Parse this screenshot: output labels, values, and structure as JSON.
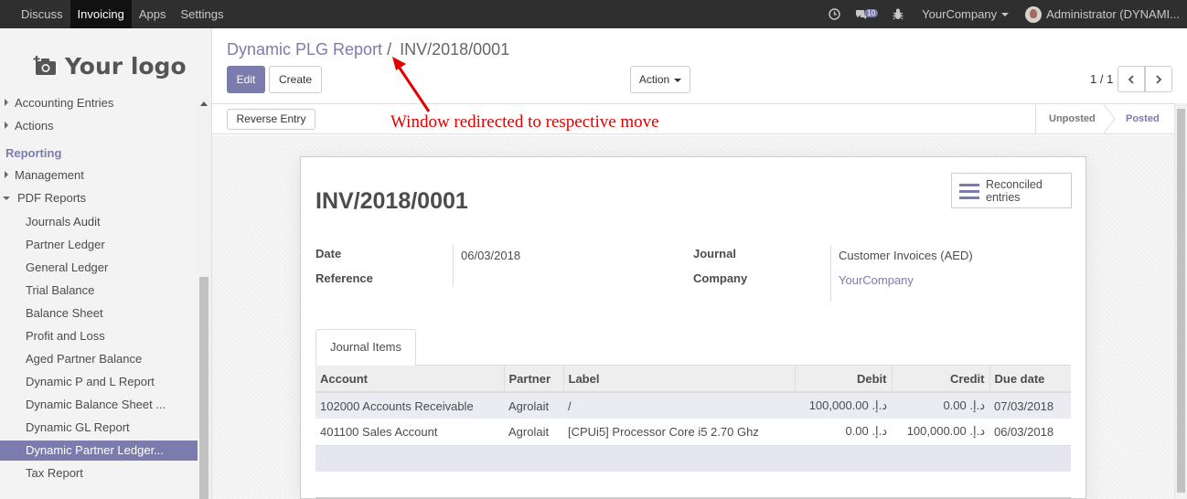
{
  "topbar": {
    "menu": [
      "Discuss",
      "Invoicing",
      "Apps",
      "Settings"
    ],
    "active_index": 1,
    "messages_count": "10",
    "company": "YourCompany",
    "user": "Administrator (DYNAMI..."
  },
  "sidebar": {
    "logo_text": "Your logo",
    "items": [
      {
        "type": "group",
        "label": "Accounting Entries"
      },
      {
        "type": "group",
        "label": "Actions"
      },
      {
        "type": "head",
        "label": "Reporting"
      },
      {
        "type": "group",
        "label": "Management"
      },
      {
        "type": "group-open",
        "label": "PDF Reports"
      },
      {
        "type": "sub",
        "label": "Journals Audit"
      },
      {
        "type": "sub",
        "label": "Partner Ledger"
      },
      {
        "type": "sub",
        "label": "General Ledger"
      },
      {
        "type": "sub",
        "label": "Trial Balance"
      },
      {
        "type": "sub",
        "label": "Balance Sheet"
      },
      {
        "type": "sub",
        "label": "Profit and Loss"
      },
      {
        "type": "sub",
        "label": "Aged Partner Balance"
      },
      {
        "type": "sub",
        "label": "Dynamic P and L Report"
      },
      {
        "type": "sub",
        "label": "Dynamic Balance Sheet ..."
      },
      {
        "type": "sub",
        "label": "Dynamic GL Report"
      },
      {
        "type": "sub-selected",
        "label": "Dynamic Partner Ledger..."
      },
      {
        "type": "sub",
        "label": "Tax Report"
      }
    ]
  },
  "breadcrumb": {
    "parent": "Dynamic PLG Report",
    "separator": "/",
    "current": "INV/2018/0001"
  },
  "buttons": {
    "edit": "Edit",
    "create": "Create",
    "action": "Action",
    "reverse": "Reverse Entry"
  },
  "pager": {
    "value": "1 / 1"
  },
  "statusbar": {
    "stages": [
      "Unposted",
      "Posted"
    ],
    "active": "Posted"
  },
  "annotation": "Window redirected to respective move",
  "form": {
    "name": "INV/2018/0001",
    "reconciled_label_1": "Reconciled",
    "reconciled_label_2": "entries",
    "date_label": "Date",
    "date_value": "06/03/2018",
    "reference_label": "Reference",
    "reference_value": "",
    "journal_label": "Journal",
    "journal_value": "Customer Invoices (AED)",
    "company_label": "Company",
    "company_value": "YourCompany"
  },
  "tab": {
    "label": "Journal Items"
  },
  "table": {
    "headers": [
      "Account",
      "Partner",
      "Label",
      "Debit",
      "Credit",
      "Due date"
    ],
    "rows": [
      [
        "102000 Accounts Receivable",
        "Agrolait",
        "/",
        "100,000.00 .د.إ",
        "0.00 .د.إ",
        "07/03/2018"
      ],
      [
        "401100 Sales Account",
        "Agrolait",
        "[CPUi5] Processor Core i5 2.70 Ghz",
        "0.00 .د.إ",
        "100,000.00 .د.إ",
        "06/03/2018"
      ]
    ]
  },
  "colors": {
    "accent": "#7c7bad",
    "topbar": "#2f2f2f",
    "annotation": "#e10000"
  }
}
